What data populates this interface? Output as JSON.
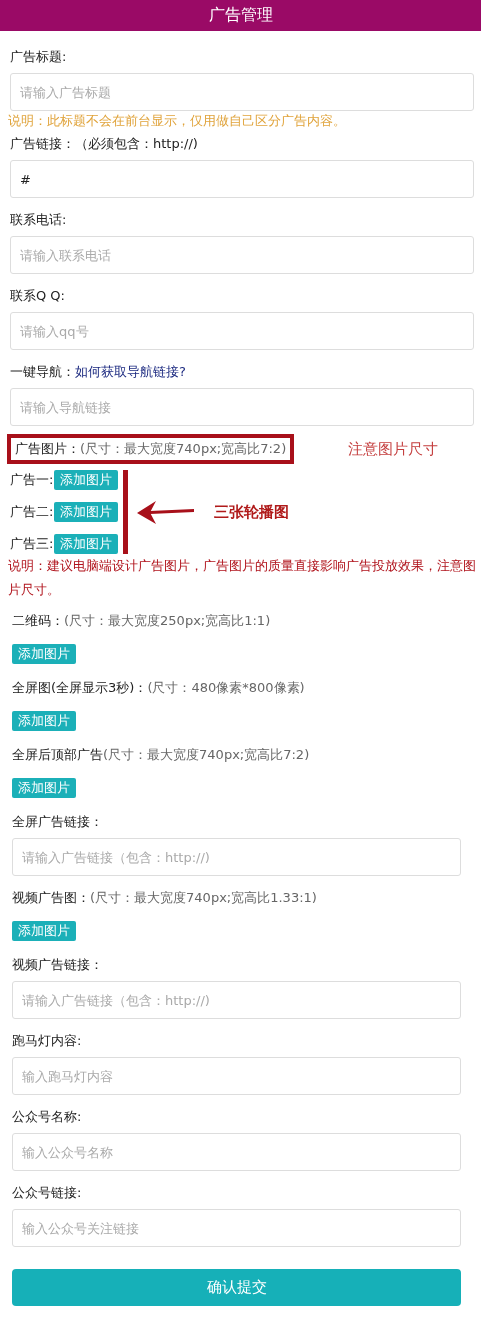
{
  "header": {
    "title": "广告管理"
  },
  "sections": [
    {
      "items": [
        {
          "kind": "field",
          "label": "广告标题:",
          "placeholder": "请输入广告标题"
        },
        {
          "kind": "note",
          "color": "#e0a33a",
          "text": "说明：此标题不会在前台显示，仅用做自己区分广告内容。"
        },
        {
          "kind": "field",
          "label": "广告链接：",
          "hint": "（必须包含：http://)",
          "value": "#"
        },
        {
          "kind": "field",
          "label": "联系电话:",
          "placeholder": "请输入联系电话"
        },
        {
          "kind": "field",
          "label": "联系Q Q:",
          "placeholder": "请输入qq号"
        },
        {
          "kind": "field",
          "label": "一键导航：",
          "link": "如何获取导航链接?",
          "placeholder": "请输入导航链接"
        },
        {
          "kind": "slides",
          "label": "广告图片：",
          "hint": "(尺寸：最大宽度740px;宽高比7:2)",
          "callout": "注意图片尺寸",
          "arrow_note": "三张轮播图",
          "slides": [
            {
              "label": "广告一:",
              "button": "添加图片"
            },
            {
              "label": "广告二:",
              "button": "添加图片"
            },
            {
              "label": "广告三:",
              "button": "添加图片"
            }
          ]
        },
        {
          "kind": "note",
          "color": "#b0121b",
          "text": "说明：建议电脑端设计广告图片，广告图片的质量直接影响广告投放效果，注意图片尺寸。"
        }
      ]
    },
    {
      "items": [
        {
          "kind": "upload",
          "label": "二维码：",
          "hint": "(尺寸：最大宽度250px;宽高比1:1)",
          "button": "添加图片"
        },
        {
          "kind": "upload",
          "label": "全屏图(全屏显示3秒)：",
          "hint": "(尺寸：480像素*800像素)",
          "button": "添加图片"
        },
        {
          "kind": "upload",
          "label": "全屏后顶部广告",
          "hint": "(尺寸：最大宽度740px;宽高比7:2)",
          "button": "添加图片"
        },
        {
          "kind": "field",
          "label": "全屏广告链接：",
          "placeholder": "请输入广告链接（包含：http://)"
        },
        {
          "kind": "upload",
          "label": "视频广告图：",
          "hint": "(尺寸：最大宽度740px;宽高比1.33:1)",
          "button": "添加图片"
        },
        {
          "kind": "field",
          "label": "视频广告链接：",
          "placeholder": "请输入广告链接（包含：http://)"
        },
        {
          "kind": "field",
          "label": "跑马灯内容:",
          "placeholder": "输入跑马灯内容"
        },
        {
          "kind": "field",
          "label": "公众号名称:",
          "placeholder": "输入公众号名称"
        },
        {
          "kind": "field",
          "label": "公众号链接:",
          "placeholder": "输入公众号关注链接"
        }
      ]
    }
  ],
  "submit": {
    "label": "确认提交"
  }
}
